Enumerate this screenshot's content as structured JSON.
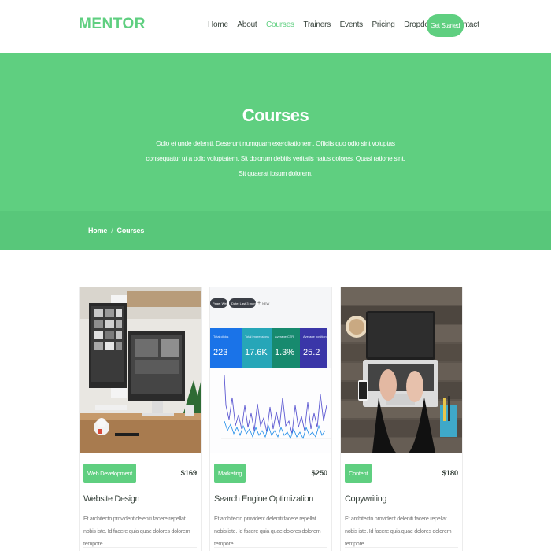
{
  "header": {
    "logo": "MENTOR",
    "nav": [
      "Home",
      "About",
      "Courses",
      "Trainers",
      "Events",
      "Pricing",
      "Dropdown",
      "Contact"
    ],
    "active_nav": "Courses",
    "cta": "Get Started"
  },
  "hero": {
    "title": "Courses",
    "text": "Odio et unde deleniti. Deserunt numquam exercitationem. Officiis quo odio sint voluptas consequatur ut a odio voluptatem. Sit dolorum debitis veritatis natus dolores. Quasi ratione sint. Sit quaerat ipsum dolorem."
  },
  "breadcrumb": [
    "Home",
    "Courses"
  ],
  "courses": [
    {
      "category": "Web Development",
      "price": "$169",
      "title": "Website Design",
      "description": "Et architecto provident deleniti facere repellat nobis iste. Id facere quia quae dolores dolorem tempore."
    },
    {
      "category": "Marketing",
      "price": "$250",
      "title": "Search Engine Optimization",
      "description": "Et architecto provident deleniti facere repellat nobis iste. Id facere quia quae dolores dolorem tempore.",
      "image_text": {
        "chips": [
          "Page: Web",
          "Date: Last 3 months",
          "NEW"
        ],
        "metrics": [
          {
            "label": "Total clicks",
            "value": "223"
          },
          {
            "label": "Total impressions",
            "value": "17.6K"
          },
          {
            "label": "Average CTR",
            "value": "1.3%"
          },
          {
            "label": "Average position",
            "value": "25.2"
          }
        ]
      }
    },
    {
      "category": "Content",
      "price": "$180",
      "title": "Copywriting",
      "description": "Et architecto provident deleniti facere repellat nobis iste. Id facere quia quae dolores dolorem tempore."
    }
  ],
  "colors": {
    "accent": "#5fcf80",
    "breadcrumb_bg": "#58c77a",
    "text": "#37423b"
  }
}
